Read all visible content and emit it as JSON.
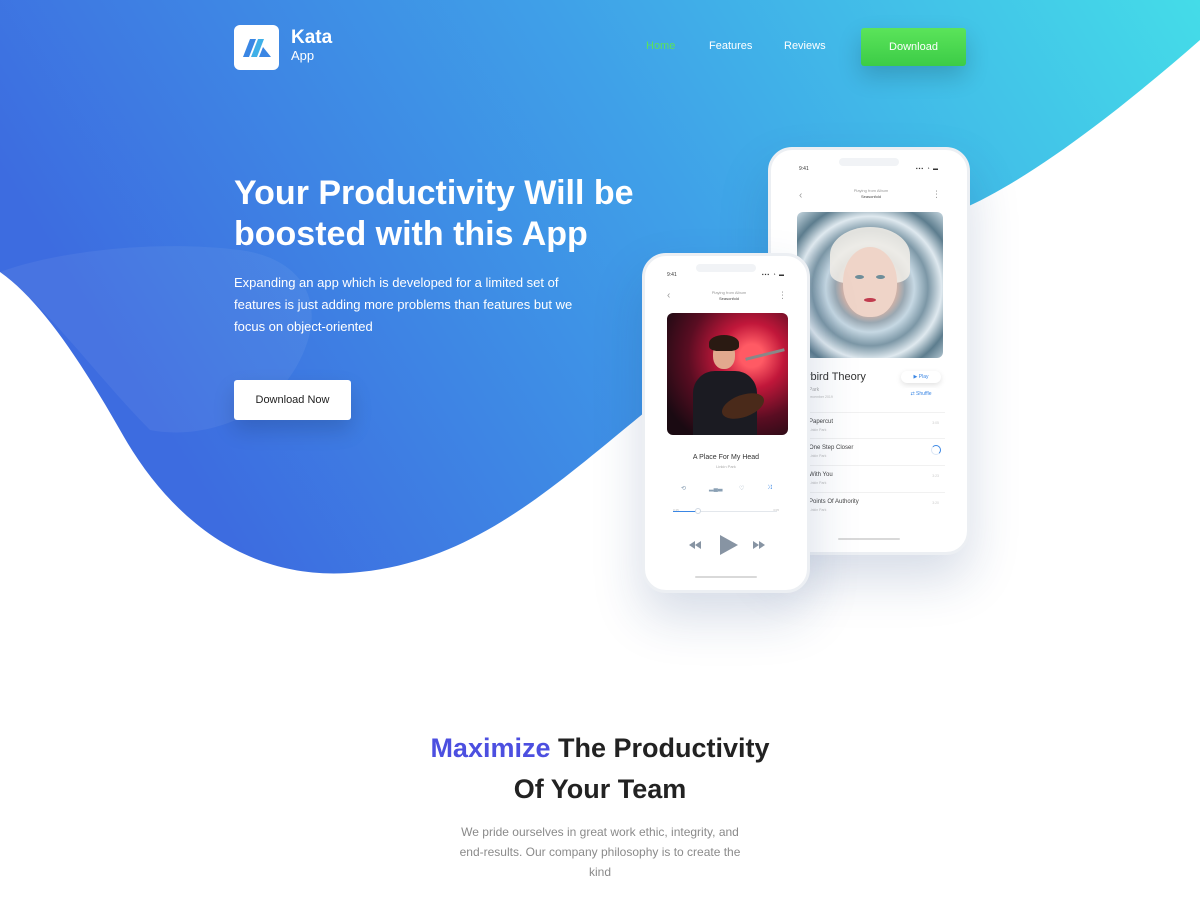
{
  "brand": {
    "name": "Kata",
    "sub": "App"
  },
  "nav": {
    "items": [
      {
        "label": "Home",
        "active": true
      },
      {
        "label": "Features",
        "active": false
      },
      {
        "label": "Reviews",
        "active": false
      }
    ],
    "download_label": "Download"
  },
  "hero": {
    "title_strong": "Your Productivity",
    "title_rest": " Will be boosted with this App",
    "description": "Expanding an app which is developed for a limited set of features is just adding more problems than features but we focus on object-oriented",
    "cta_label": "Download Now"
  },
  "phone_back": {
    "time": "9:41",
    "header_top": "Playing from Album",
    "header_sub": "Seasonfold",
    "album_title": "ybird Theory",
    "album_artist": "k Park",
    "album_date": "2 December 2019",
    "play_label": "▶ Play",
    "shuffle_label": "⇄ Shuffle",
    "tracks": [
      {
        "title": "Papercut",
        "artist": "Linkin Park",
        "duration": "3:05"
      },
      {
        "title": "One Step Closer",
        "artist": "Linkin Park",
        "duration": ""
      },
      {
        "title": "With You",
        "artist": "Linkin Park",
        "duration": "3:23"
      },
      {
        "title": "Points Of Authority",
        "artist": "Linkin Park",
        "duration": "3:20"
      }
    ]
  },
  "phone_front": {
    "time": "9:41",
    "header_top": "Playing from Album",
    "header_sub": "Seasonfold",
    "song_title": "A Place For My Head",
    "song_artist": "Linkin Park",
    "elapsed": "0:45",
    "total": "3:05",
    "progress": 0.24
  },
  "section": {
    "title_accent": "Maximize",
    "title_rest": " The Productivity",
    "title_line2": "Of Your Team",
    "description": "We pride ourselves in great work ethic, integrity, and end-results. Our company philosophy is to create the kind"
  },
  "colors": {
    "gradient_start": "#3f6fdf",
    "gradient_end": "#44d9e8",
    "nav_active": "#5ce25a",
    "button_green": "#47d650",
    "accent_purple": "#4c4fe0",
    "player_accent": "#3a86e4"
  },
  "icons": [
    "logo-icon",
    "back-arrow-icon",
    "more-icon",
    "play-icon",
    "shuffle-icon",
    "rewind-icon",
    "forward-icon",
    "repeat-icon",
    "equalizer-icon",
    "heart-icon"
  ]
}
